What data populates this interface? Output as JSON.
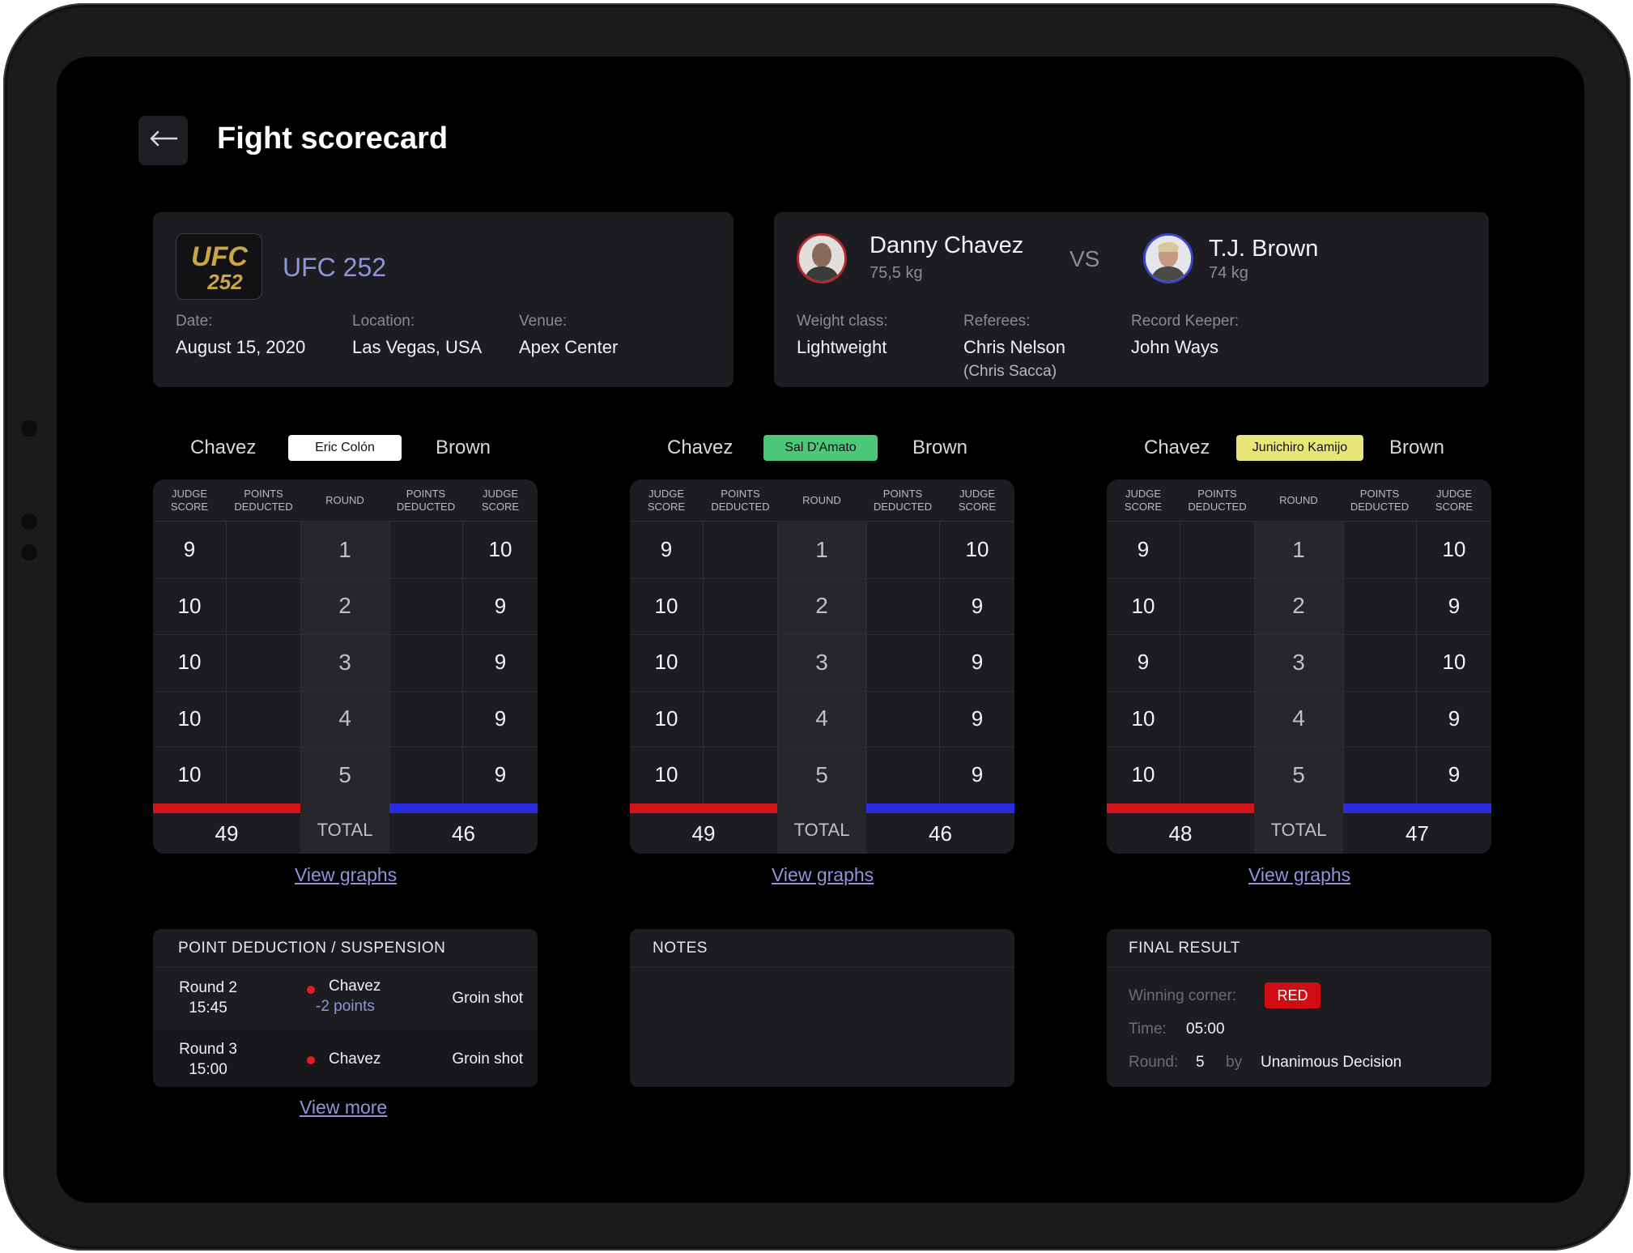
{
  "header": {
    "title": "Fight scorecard"
  },
  "event": {
    "name": "UFC 252",
    "logo_line1": "UFC",
    "logo_line2": "252",
    "date_label": "Date:",
    "date": "August 15, 2020",
    "location_label": "Location:",
    "location": "Las Vegas, USA",
    "venue_label": "Venue:",
    "venue": "Apex Center"
  },
  "fight": {
    "red": {
      "name": "Danny Chavez",
      "weight": "75,5 kg"
    },
    "vs": "VS",
    "blue": {
      "name": "T.J. Brown",
      "weight": "74 kg"
    },
    "weight_class_label": "Weight class:",
    "weight_class": "Lightweight",
    "referees_label": "Referees:",
    "referee": "Chris Nelson",
    "referee_sub": "(Chris Sacca)",
    "record_keeper_label": "Record Keeper:",
    "record_keeper": "John Ways"
  },
  "scorecard_columns": {
    "judge_score": "JUDGE SCORE",
    "points_deducted": "POINTS DEDUCTED",
    "round": "ROUND",
    "total": "TOTAL"
  },
  "judges": [
    {
      "red_name": "Chavez",
      "blue_name": "Brown",
      "judge": "Eric Colón",
      "badge_color": "#ffffff",
      "rounds": [
        {
          "round": "1",
          "red": "9",
          "blue": "10"
        },
        {
          "round": "2",
          "red": "10",
          "blue": "9"
        },
        {
          "round": "3",
          "red": "10",
          "blue": "9"
        },
        {
          "round": "4",
          "red": "10",
          "blue": "9"
        },
        {
          "round": "5",
          "red": "10",
          "blue": "9"
        }
      ],
      "red_total": "49",
      "blue_total": "46",
      "link": "View graphs"
    },
    {
      "red_name": "Chavez",
      "blue_name": "Brown",
      "judge": "Sal D'Amato",
      "badge_color": "#4cc87a",
      "rounds": [
        {
          "round": "1",
          "red": "9",
          "blue": "10"
        },
        {
          "round": "2",
          "red": "10",
          "blue": "9"
        },
        {
          "round": "3",
          "red": "10",
          "blue": "9"
        },
        {
          "round": "4",
          "red": "10",
          "blue": "9"
        },
        {
          "round": "5",
          "red": "10",
          "blue": "9"
        }
      ],
      "red_total": "49",
      "blue_total": "46",
      "link": "View graphs"
    },
    {
      "red_name": "Chavez",
      "blue_name": "Brown",
      "judge": "Junichiro Kamijo",
      "badge_color": "#e8e57a",
      "rounds": [
        {
          "round": "1",
          "red": "9",
          "blue": "10"
        },
        {
          "round": "2",
          "red": "10",
          "blue": "9"
        },
        {
          "round": "3",
          "red": "9",
          "blue": "10"
        },
        {
          "round": "4",
          "red": "10",
          "blue": "9"
        },
        {
          "round": "5",
          "red": "10",
          "blue": "9"
        }
      ],
      "red_total": "48",
      "blue_total": "47",
      "link": "View graphs"
    }
  ],
  "deductions": {
    "title": "POINT DEDUCTION / SUSPENSION",
    "rows": [
      {
        "round": "Round 2",
        "time": "15:45",
        "fighter": "Chavez",
        "points": "-2 points",
        "reason": "Groin shot"
      },
      {
        "round": "Round 3",
        "time": "15:00",
        "fighter": "Chavez",
        "points": "",
        "reason": "Groin shot"
      }
    ],
    "link": "View more"
  },
  "notes": {
    "title": "NOTES"
  },
  "final_result": {
    "title": "FINAL RESULT",
    "winning_corner_label": "Winning corner:",
    "winning_corner": "RED",
    "time_label": "Time:",
    "time": "05:00",
    "round_label": "Round:",
    "round": "5",
    "by_label": "by",
    "method": "Unanimous Decision"
  },
  "icons": {
    "back": "arrow-left-icon",
    "red_avatar": "fighter-avatar",
    "blue_avatar": "fighter-avatar"
  },
  "colors": {
    "red_corner": "#d11418",
    "blue_corner": "#2b2be0",
    "accent_link": "#8f95d6",
    "ufc_gold": "#c9a646"
  }
}
